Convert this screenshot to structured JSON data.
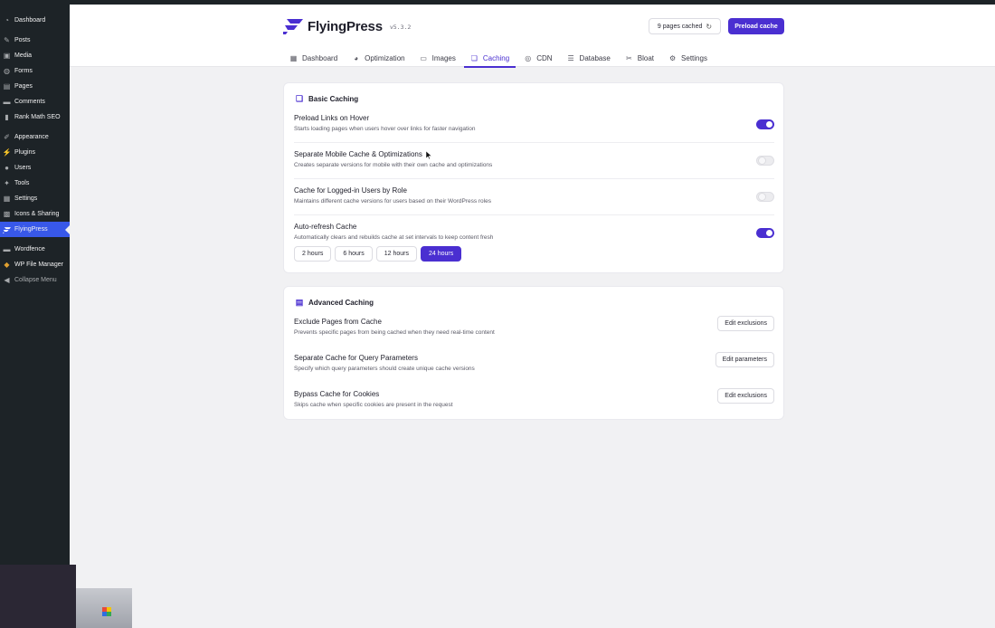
{
  "sidebar": {
    "items": [
      {
        "label": "Dashboard",
        "icon": "dashboard-icon"
      },
      {
        "label": "Posts",
        "icon": "pin-icon"
      },
      {
        "label": "Media",
        "icon": "media-icon"
      },
      {
        "label": "Forms",
        "icon": "forms-icon"
      },
      {
        "label": "Pages",
        "icon": "page-icon"
      },
      {
        "label": "Comments",
        "icon": "comment-icon"
      },
      {
        "label": "Rank Math SEO",
        "icon": "rank-math-icon"
      },
      {
        "label": "Appearance",
        "icon": "brush-icon"
      },
      {
        "label": "Plugins",
        "icon": "plug-icon"
      },
      {
        "label": "Users",
        "icon": "user-icon"
      },
      {
        "label": "Tools",
        "icon": "wrench-icon"
      },
      {
        "label": "Settings",
        "icon": "settings-icon"
      },
      {
        "label": "Icons & Sharing",
        "icon": "grid-icon"
      },
      {
        "label": "FlyingPress",
        "icon": "flyingpress-icon"
      },
      {
        "label": "Wordfence",
        "icon": "wordfence-icon"
      },
      {
        "label": "WP File Manager",
        "icon": "folder-icon"
      },
      {
        "label": "Collapse Menu",
        "icon": "collapse-icon"
      }
    ]
  },
  "header": {
    "brand": "FlyingPress",
    "version": "v5.3.2",
    "pages_cached": "9 pages cached",
    "preload_label": "Preload cache",
    "accent": "#4a2fd1"
  },
  "tabs": [
    {
      "label": "Dashboard",
      "icon": "grid-icon"
    },
    {
      "label": "Optimization",
      "icon": "gauge-icon"
    },
    {
      "label": "Images",
      "icon": "image-icon"
    },
    {
      "label": "Caching",
      "icon": "cache-icon",
      "active": true
    },
    {
      "label": "CDN",
      "icon": "globe-icon"
    },
    {
      "label": "Database",
      "icon": "database-icon"
    },
    {
      "label": "Bloat",
      "icon": "scissors-icon"
    },
    {
      "label": "Settings",
      "icon": "settings-icon"
    }
  ],
  "basic": {
    "title": "Basic Caching",
    "rows": [
      {
        "title": "Preload Links on Hover",
        "desc": "Starts loading pages when users hover over links for faster navigation",
        "enabled": true
      },
      {
        "title": "Separate Mobile Cache & Optimizations",
        "desc": "Creates separate versions for mobile with their own cache and optimizations",
        "enabled": false
      },
      {
        "title": "Cache for Logged-in Users by Role",
        "desc": "Maintains different cache versions for users based on their WordPress roles",
        "enabled": false
      },
      {
        "title": "Auto-refresh Cache",
        "desc": "Automatically clears and rebuilds cache at set intervals to keep content fresh",
        "enabled": true
      }
    ],
    "intervals": [
      "2 hours",
      "6 hours",
      "12 hours",
      "24 hours"
    ],
    "selected_interval": "24 hours"
  },
  "advanced": {
    "title": "Advanced Caching",
    "rows": [
      {
        "title": "Exclude Pages from Cache",
        "desc": "Prevents specific pages from being cached when they need real-time content",
        "button": "Edit exclusions"
      },
      {
        "title": "Separate Cache for Query Parameters",
        "desc": "Specify which query parameters should create unique cache versions",
        "button": "Edit parameters"
      },
      {
        "title": "Bypass Cache for Cookies",
        "desc": "Skips cache when specific cookies are present in the request",
        "button": "Edit exclusions"
      }
    ]
  }
}
